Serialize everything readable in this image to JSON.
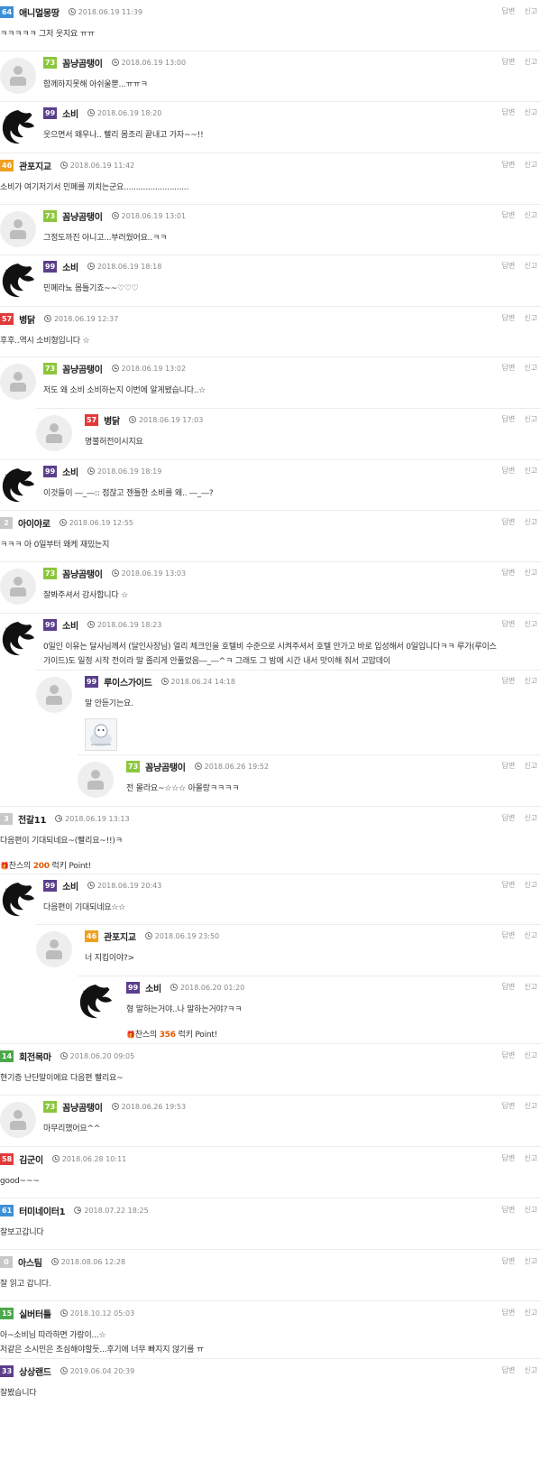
{
  "actions": {
    "reply": "답변",
    "report": "신고"
  },
  "comments": [
    {
      "level": "64",
      "level_color": "#3d8fd6",
      "user": "애니멀몽땅",
      "date": "2018.06.19 11:39",
      "lines": [
        "ㅋㅋㅋㅋㅋ 그저 웃지요 ㅠㅠ"
      ],
      "indent": 0,
      "avatar": "none",
      "height": 56
    },
    {
      "level": "73",
      "level_color": "#8cc63f",
      "user": "꼼냥곰탱이",
      "date": "2018.06.19 13:00",
      "lines": [
        "함께하지못해 아쉬울뿐...ㅠㅠㅋ"
      ],
      "indent": 1,
      "avatar": "default",
      "height": 56
    },
    {
      "level": "99",
      "level_color": "#5b3f8c",
      "user": "소비",
      "date": "2018.06.19 18:20",
      "lines": [
        "웃으면서 왜우나.. 빨리 몸조리 끝내고 가자~~!!"
      ],
      "indent": 1,
      "avatar": "dark",
      "height": 57
    },
    {
      "level": "46",
      "level_color": "#f0a020",
      "user": "관포지교",
      "date": "2018.06.19 11:42",
      "lines": [
        "소비가 여기저기서 민폐를 끼치는군요..........................."
      ],
      "indent": 0,
      "avatar": "none",
      "height": 57
    },
    {
      "level": "73",
      "level_color": "#8cc63f",
      "user": "꼼냥곰탱이",
      "date": "2018.06.19 13:01",
      "lines": [
        "그정도까진 아니고...부러웠어요..ㅋㅋ"
      ],
      "indent": 1,
      "avatar": "default",
      "height": 56
    },
    {
      "level": "99",
      "level_color": "#5b3f8c",
      "user": "소비",
      "date": "2018.06.19 18:18",
      "lines": [
        "민폐라뇨 몸틀기죠~~♡♡♡"
      ],
      "indent": 1,
      "avatar": "dark",
      "height": 57
    },
    {
      "level": "57",
      "level_color": "#e23a3a",
      "user": "병닭",
      "date": "2018.06.19 12:37",
      "lines": [
        "후후..역시 소비형입니다 ☆"
      ],
      "indent": 0,
      "avatar": "none",
      "height": 56
    },
    {
      "level": "73",
      "level_color": "#8cc63f",
      "user": "꼼냥곰탱이",
      "date": "2018.06.19 13:02",
      "lines": [
        "저도 왜 소비 소비하는지 이번에 알게됐습니다..☆"
      ],
      "indent": 1,
      "avatar": "default",
      "height": 57
    },
    {
      "level": "57",
      "level_color": "#e23a3a",
      "user": "병닭",
      "date": "2018.06.19 17:03",
      "lines": [
        "명불허전이시지요"
      ],
      "indent": 2,
      "avatar": "default",
      "height": 57
    },
    {
      "level": "99",
      "level_color": "#5b3f8c",
      "user": "소비",
      "date": "2018.06.19 18:19",
      "lines": [
        "이것들이 ―_―:: 점잖고 젠틀한 소비를 왜..  ―_―?"
      ],
      "indent": 1,
      "avatar": "dark",
      "height": 56
    },
    {
      "level": "2",
      "level_color": "#c8c8c8",
      "user": "아이야로",
      "date": "2018.06.19 12:55",
      "lines": [
        "ㅋㅋㅋ 아 0일부터 왜케 재밌는지"
      ],
      "indent": 0,
      "avatar": "none",
      "height": 57
    },
    {
      "level": "73",
      "level_color": "#8cc63f",
      "user": "꼼냥곰탱이",
      "date": "2018.06.19 13:03",
      "lines": [
        "잘봐주셔서 감사합니다 ☆"
      ],
      "indent": 1,
      "avatar": "default",
      "height": 57
    },
    {
      "level": "99",
      "level_color": "#5b3f8c",
      "user": "소비",
      "date": "2018.06.19 18:23",
      "lines": [
        "0일인 이유는 달사님께서 (달인사장님) 얼리 체크인을 호텔비 수준으로 시켜주셔서 호텔 안가고 바로 입성해서 0일입니다ㅋㅋ 루가(루이스",
        "가이드)도 일정 시작 전이라 말 졸리게 안풀었음―_―^ㅋ 그래도 그 밤에 시간 내서 맛이해 줘서 고맙데이"
      ],
      "indent": 1,
      "avatar": "dark",
      "height": 63
    },
    {
      "level": "99",
      "level_color": "#5b3f8c",
      "user": "루이스가이드",
      "date": "2018.06.24 14:18",
      "lines": [
        "말 안듣기는요."
      ],
      "indent": 2,
      "avatar": "default",
      "height": 94,
      "sticker": true
    },
    {
      "level": "73",
      "level_color": "#8cc63f",
      "user": "꼼냥곰탱이",
      "date": "2018.06.26 19:52",
      "lines": [
        "전 몰라요~☆☆☆ 아몰랑ㅋㅋㅋㅋ"
      ],
      "indent": 3,
      "avatar": "default",
      "height": 57
    },
    {
      "level": "3",
      "level_color": "#c8c8c8",
      "user": "전갈11",
      "date": "2018.06.19 13:13",
      "lines": [
        "다음편이 기대되네요~(빨리요~!!)ㅋ"
      ],
      "indent": 0,
      "avatar": "none",
      "height": 75,
      "point": {
        "pre": "찬스의",
        "value": "200",
        "post": "럭키 Point!"
      }
    },
    {
      "level": "99",
      "level_color": "#5b3f8c",
      "user": "소비",
      "date": "2018.06.19 20:43",
      "lines": [
        "다음편이 기대되네요☆☆"
      ],
      "indent": 1,
      "avatar": "dark",
      "height": 56
    },
    {
      "level": "46",
      "level_color": "#f0a020",
      "user": "관포지교",
      "date": "2018.06.19 23:50",
      "lines": [
        "너 지킴이야?>"
      ],
      "indent": 2,
      "avatar": "default",
      "height": 57
    },
    {
      "level": "99",
      "level_color": "#5b3f8c",
      "user": "소비",
      "date": "2018.06.20 01:20",
      "lines": [
        "형 말하는거야..나 말하는거야?ㅋㅋ"
      ],
      "indent": 3,
      "avatar": "dark",
      "height": 75,
      "point": {
        "pre": "찬스의",
        "value": "356",
        "post": "럭키 Point!"
      }
    },
    {
      "level": "14",
      "level_color": "#4aa84a",
      "user": "회전목마",
      "date": "2018.06.20 09:05",
      "lines": [
        "현기증 난단말이에요 다음편 빨리요~"
      ],
      "indent": 0,
      "avatar": "none",
      "height": 57
    },
    {
      "level": "73",
      "level_color": "#8cc63f",
      "user": "꼼냥곰탱이",
      "date": "2018.06.26 19:53",
      "lines": [
        "마무리했어요^^"
      ],
      "indent": 1,
      "avatar": "default",
      "height": 57
    },
    {
      "level": "58",
      "level_color": "#e23a3a",
      "user": "김군이",
      "date": "2018.06.28 10:11",
      "lines": [
        "good~~~"
      ],
      "indent": 0,
      "avatar": "none",
      "height": 57
    },
    {
      "level": "61",
      "level_color": "#3d8fd6",
      "user": "터미네이터1",
      "date": "2018.07.22 18:25",
      "lines": [
        "잘보고갑니다"
      ],
      "indent": 0,
      "avatar": "none",
      "height": 57
    },
    {
      "level": "0",
      "level_color": "#c8c8c8",
      "user": "아스팀",
      "date": "2018.08.06 12:28",
      "lines": [
        "잘 읽고 갑니다."
      ],
      "indent": 0,
      "avatar": "none",
      "height": 57
    },
    {
      "level": "15",
      "level_color": "#4aa84a",
      "user": "실버터틀",
      "date": "2018.10.12 05:03",
      "lines": [
        "아~소비님 따라하면 가랑이...☆",
        "저같은 소시민은 조심해야할듯...후기에 너무 빠지지 않기를 ㅠ"
      ],
      "indent": 0,
      "avatar": "none",
      "height": 64
    },
    {
      "level": "33",
      "level_color": "#5b3f8c",
      "user": "상상랜드",
      "date": "2019.06.04 20:39",
      "lines": [
        "잘봤습니다"
      ],
      "indent": 0,
      "avatar": "none",
      "height": 44
    }
  ]
}
